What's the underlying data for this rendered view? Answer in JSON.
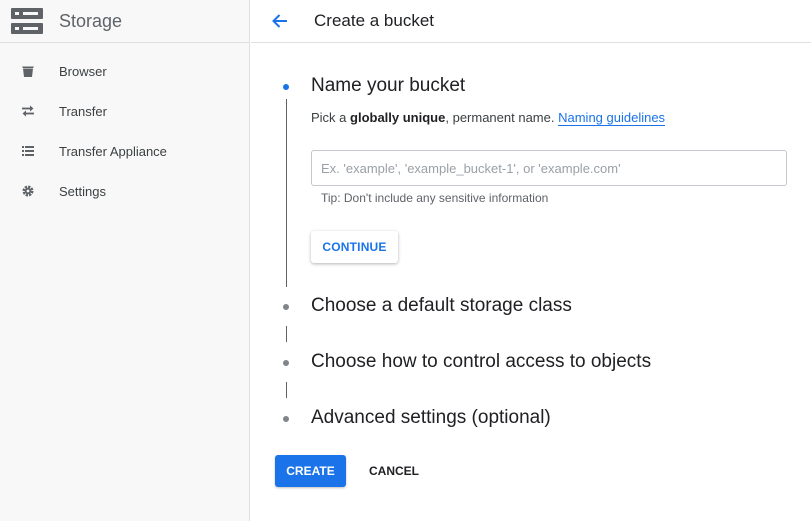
{
  "sidebar": {
    "product_title": "Storage",
    "items": [
      {
        "label": "Browser",
        "icon": "bucket-icon"
      },
      {
        "label": "Transfer",
        "icon": "transfer-arrows-icon"
      },
      {
        "label": "Transfer Appliance",
        "icon": "list-icon"
      },
      {
        "label": "Settings",
        "icon": "gear-icon"
      }
    ]
  },
  "header": {
    "back_icon": "arrow-back-icon",
    "title": "Create a bucket"
  },
  "steps": [
    {
      "title": "Name your bucket",
      "active": true
    },
    {
      "title": "Choose a default storage class",
      "active": false
    },
    {
      "title": "Choose how to control access to objects",
      "active": false
    },
    {
      "title": "Advanced settings (optional)",
      "active": false
    }
  ],
  "name_step": {
    "desc_prefix": "Pick a ",
    "desc_bold": "globally unique",
    "desc_suffix": ", permanent name.",
    "link_label": "Naming guidelines",
    "input_value": "",
    "input_placeholder": "Ex. 'example', 'example_bucket-1', or 'example.com'",
    "tip": "Tip: Don't include any sensitive information",
    "continue_label": "CONTINUE"
  },
  "actions": {
    "create_label": "CREATE",
    "cancel_label": "CANCEL"
  },
  "colors": {
    "accent": "#1a73e8",
    "sidebar_bg": "#f8f8f8",
    "step_inactive": "#80868b"
  }
}
